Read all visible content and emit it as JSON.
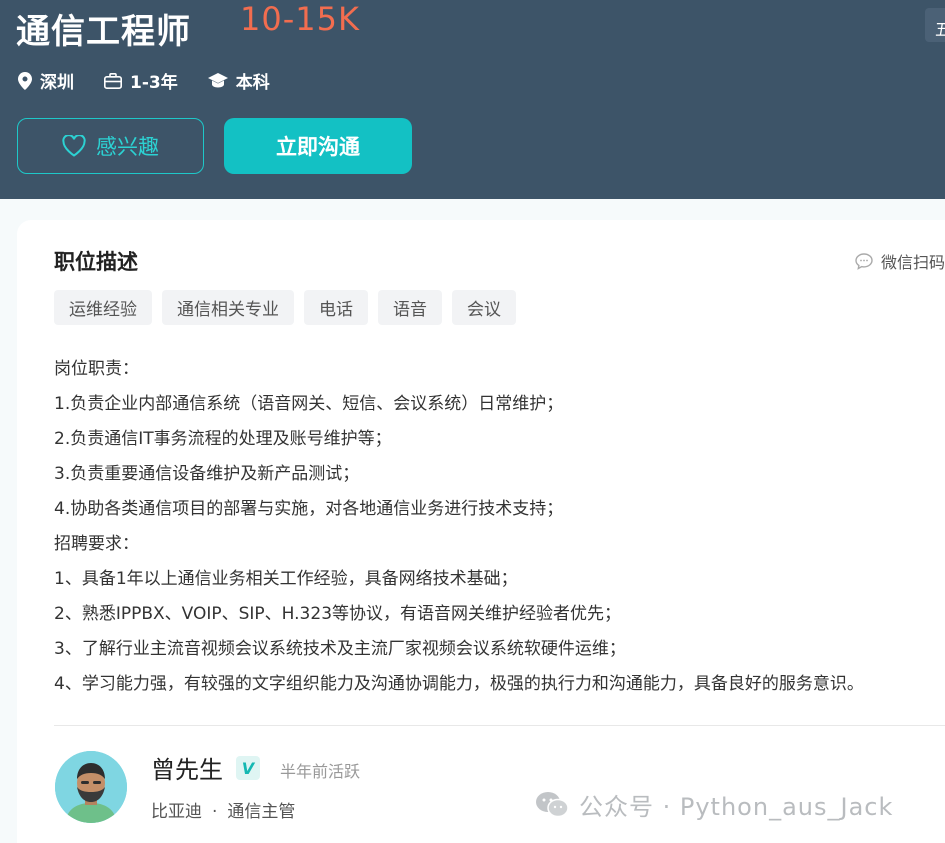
{
  "header": {
    "job_title": "通信工程师",
    "salary": "10-15K",
    "corner_tag": "五",
    "location": "深圳",
    "experience": "1-3年",
    "education": "本科",
    "interest_button": "感兴趣",
    "chat_button": "立即沟通"
  },
  "description": {
    "section_title": "职位描述",
    "wechat_scan": "微信扫码",
    "tags": [
      "运维经验",
      "通信相关专业",
      "电话",
      "语音",
      "会议"
    ],
    "lines": [
      "岗位职责：",
      "1.负责企业内部通信系统（语音网关、短信、会议系统）日常维护；",
      "2.负责通信IT事务流程的处理及账号维护等；",
      "3.负责重要通信设备维护及新产品测试；",
      "4.协助各类通信项目的部署与实施，对各地通信业务进行技术支持；",
      "招聘要求：",
      "1、具备1年以上通信业务相关工作经验，具备网络技术基础；",
      "2、熟悉IPPBX、VOIP、SIP、H.323等协议，有语音网关维护经验者优先；",
      "3、了解行业主流音视频会议系统技术及主流厂家视频会议系统软硬件运维；",
      "4、学习能力强，有较强的文字组织能力及沟通协调能力，极强的执行力和沟通能力，具备良好的服务意识。"
    ]
  },
  "recruiter": {
    "name": "曾先生",
    "verify_badge": "V",
    "active_status": "半年前活跃",
    "company": "比亚迪",
    "separator": "·",
    "position": "通信主管"
  },
  "watermark": {
    "text": "公众号 · Python_aus_Jack"
  },
  "colors": {
    "header_bg": "#3d5468",
    "salary": "#f26d4f",
    "accent": "#13c1c4"
  }
}
